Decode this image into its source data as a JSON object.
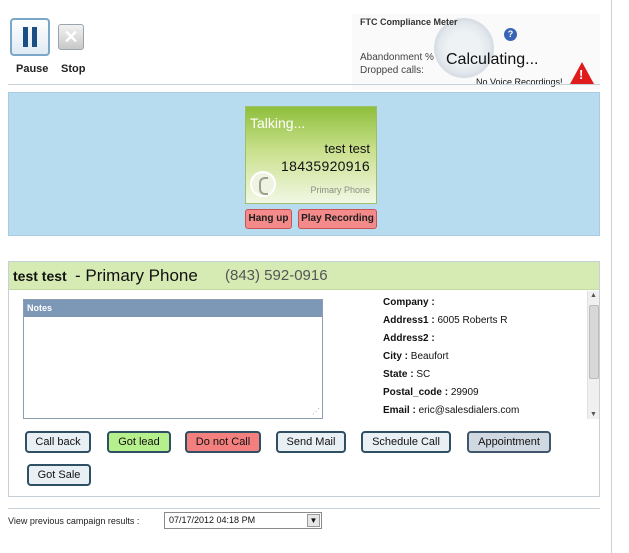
{
  "controls": {
    "pause_label": "Pause",
    "stop_label": "Stop"
  },
  "ftc": {
    "title": "FTC Compliance Meter",
    "abandonment_label": "Abandonment %",
    "dropped_label": "Dropped calls:",
    "status": "Calculating...",
    "no_recordings": "No Voice Recordings!",
    "help_glyph": "?",
    "warn_glyph": "!"
  },
  "call": {
    "status": "Talking...",
    "name": "test test",
    "number": "18435920916",
    "phone_type": "Primary Phone",
    "hangup_label": "Hang up",
    "play_label": "Play Recording"
  },
  "lead": {
    "name": "test test",
    "dash_phone_type": "- Primary Phone",
    "phone": "(843) 592-0916",
    "notes_title": "Notes",
    "notes_value": "",
    "details": [
      {
        "label": "Company :",
        "value": ""
      },
      {
        "label": "Address1 :",
        "value": "6005 Roberts R"
      },
      {
        "label": "Address2 :",
        "value": ""
      },
      {
        "label": "City :",
        "value": "Beaufort"
      },
      {
        "label": "State :",
        "value": "SC"
      },
      {
        "label": "Postal_code :",
        "value": "29909"
      },
      {
        "label": "Email :",
        "value": "eric@salesdialers.com"
      }
    ]
  },
  "dispositions": {
    "call_back": "Call back",
    "got_lead": "Got lead",
    "do_not_call": "Do not Call",
    "send_mail": "Send Mail",
    "schedule_call": "Schedule Call",
    "appointment": "Appointment",
    "got_sale": "Got Sale"
  },
  "footer": {
    "label": "View previous campaign results :",
    "selected": "07/17/2012 04:18 PM"
  },
  "colors": {
    "call_panel_bg": "#b7dcf0",
    "lead_header_bg": "#d6ebb3",
    "hangup_red": "#f48a8a",
    "got_lead_green": "#b6f08c",
    "notes_header": "#7d98b6"
  }
}
